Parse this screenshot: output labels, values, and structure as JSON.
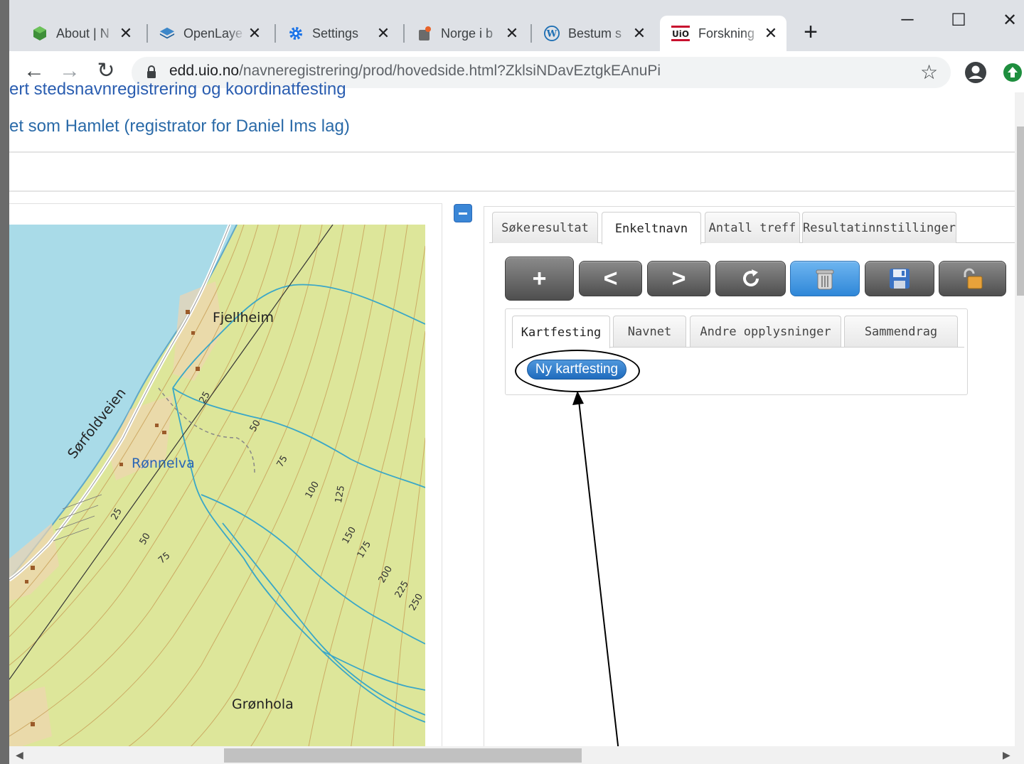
{
  "browser": {
    "tabs": [
      {
        "label": "About | N",
        "icon": "hexagon-icon"
      },
      {
        "label": "OpenLaye",
        "icon": "layers-icon"
      },
      {
        "label": "Settings",
        "icon": "gear-icon"
      },
      {
        "label": "Norge i b",
        "icon": "puzzle-icon"
      },
      {
        "label": "Bestum s",
        "icon": "wordpress-icon"
      },
      {
        "label": "Forskning",
        "icon": "uio-logo-icon"
      }
    ],
    "uio_logo_text": "UiO",
    "close_glyph": "✕",
    "new_tab_glyph": "+",
    "window": {
      "minimize": "─",
      "maximize": "☐",
      "close": "✕"
    },
    "nav": {
      "back": "←",
      "forward": "→",
      "reload": "↻"
    },
    "url_host": "edd.uio.no",
    "url_path": "/navneregistrering/prod/hovedside.html?ZklsiNDavEztgkEAnuPi",
    "star_glyph": "☆"
  },
  "page": {
    "cut_header": "ert stedsnavnregistrering og koordinatfesting",
    "title": "et som Hamlet (registrator for Daniel Ims lag)"
  },
  "map": {
    "labels": {
      "fjellheim": "Fjellheim",
      "ronnelva": "Rønnelva",
      "sorfoldveien": "Sørfoldveien",
      "gronhola": "Grønhola"
    },
    "contours": [
      "25",
      "50",
      "75",
      "100",
      "125",
      "150",
      "175",
      "200",
      "225",
      "250",
      "25",
      "50",
      "75"
    ],
    "colors": {
      "land": "#dde69a",
      "water": "#a9dbe8",
      "stream": "#3aa7c7",
      "contour": "#c9a15a"
    }
  },
  "panel": {
    "tabs": [
      "Søkeresultat",
      "Enkeltnavn",
      "Antall treff",
      "Resultatinnstillinger"
    ],
    "active_tab": "Enkeltnavn",
    "toolbar": {
      "add": "+",
      "prev": "<",
      "next": ">"
    },
    "subtabs": [
      "Kartfesting",
      "Navnet",
      "Andre opplysninger",
      "Sammendrag"
    ],
    "active_subtab": "Kartfesting",
    "ny_button": "Ny kartfesting"
  },
  "colors": {
    "accent": "#2f87d8",
    "link": "#2a6aa8"
  }
}
